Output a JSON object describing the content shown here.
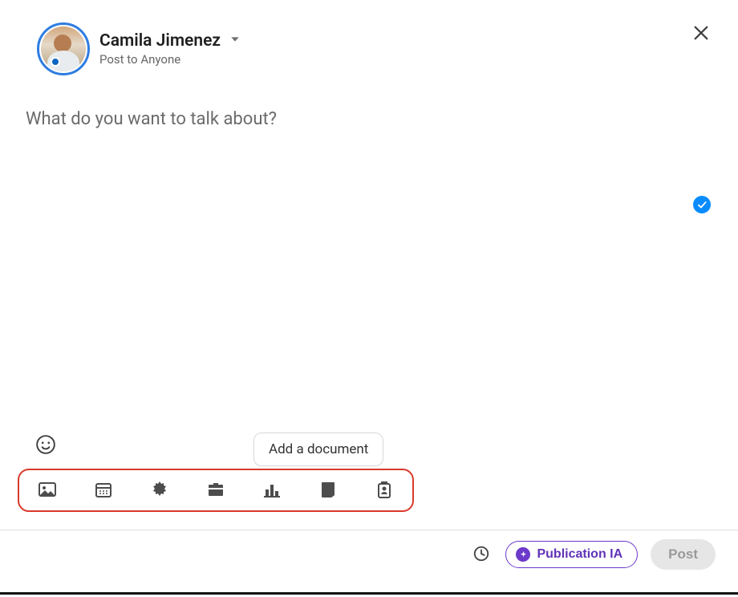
{
  "user": {
    "name": "Camila Jimenez",
    "post_to": "Post to Anyone"
  },
  "editor": {
    "placeholder": "What do you want to talk about?",
    "value": ""
  },
  "tooltip": {
    "add_document": "Add a document"
  },
  "actions": {
    "photo": "photo",
    "calendar": "event",
    "celebrate": "celebrate",
    "job": "job",
    "poll": "poll",
    "document": "document",
    "profile_attach": "find-an-expert"
  },
  "footer": {
    "publication_ia": "Publication IA",
    "post": "Post"
  },
  "colors": {
    "accent": "#0a66c2",
    "highlight_border": "#d93a2b",
    "ia_purple": "#6b3acb"
  }
}
